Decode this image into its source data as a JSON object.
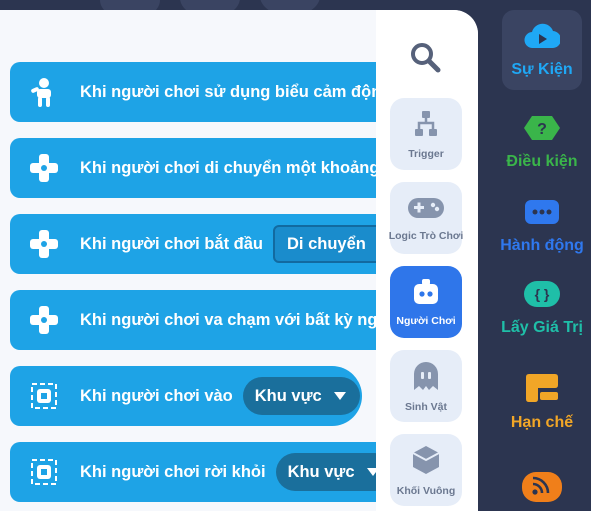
{
  "blocks": [
    {
      "text": "Khi người chơi sử dụng biểu cảm động",
      "icon": "player-emote-icon"
    },
    {
      "text": "Khi người chơi di chuyển một khoảng c",
      "icon": "dpad-icon"
    },
    {
      "text": "Khi người chơi bắt đầu",
      "icon": "dpad-icon",
      "dropdown": "Di chuyển"
    },
    {
      "text": "Khi người chơi va chạm với bất kỳ người",
      "icon": "dpad-icon"
    },
    {
      "text": "Khi người chơi vào",
      "icon": "area-icon",
      "dropdown": "Khu vực"
    },
    {
      "text": "Khi người chơi rời khỏi",
      "icon": "area-icon",
      "dropdown": "Khu vực"
    }
  ],
  "categories": [
    {
      "label": "Trigger",
      "icon": "trigger-icon"
    },
    {
      "label": "Logic Trò Chơi",
      "icon": "gamepad-icon"
    },
    {
      "label": "Người Chơi",
      "icon": "player-icon",
      "active": true
    },
    {
      "label": "Sinh Vật",
      "icon": "ghost-icon"
    },
    {
      "label": "Khối Vuông",
      "icon": "cube-icon"
    }
  ],
  "sidebar": [
    {
      "label": "Sự Kiện",
      "icon": "event-icon",
      "color": "#1fa8f5",
      "active": true
    },
    {
      "label": "Điều kiện",
      "icon": "condition-icon",
      "color": "#3ab54a"
    },
    {
      "label": "Hành động",
      "icon": "action-icon",
      "color": "#2f78ee"
    },
    {
      "label": "Lấy Giá Trị",
      "icon": "value-icon",
      "color": "#1fbfa8"
    },
    {
      "label": "Hạn chế",
      "icon": "restrict-icon",
      "color": "#f1a627"
    },
    {
      "label": "",
      "icon": "rss-icon",
      "color": "#f07f1a"
    }
  ],
  "colors": {
    "block": "#1ea3e6",
    "active_category": "#2f76ea",
    "sidebar_bg": "#2c3550"
  }
}
